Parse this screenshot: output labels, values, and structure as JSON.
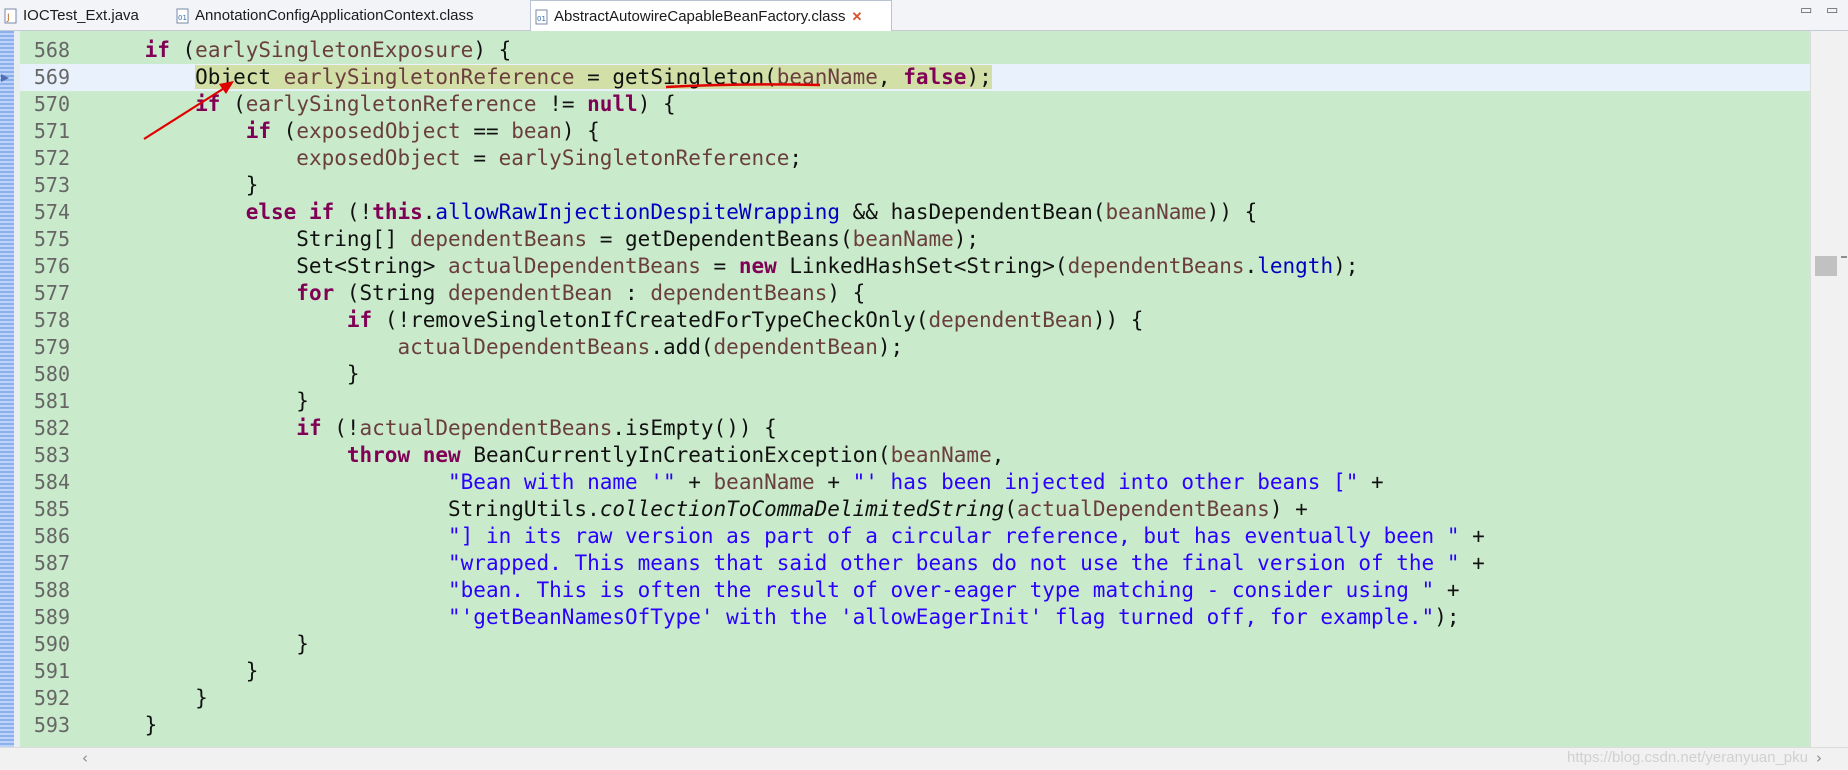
{
  "tabs": [
    {
      "label": "IOCTest_Ext.java",
      "icon": "java-file-icon",
      "active": false
    },
    {
      "label": "AnnotationConfigApplicationContext.class",
      "icon": "class-file-icon",
      "active": false
    },
    {
      "label": "AbstractAutowireCapableBeanFactory.class",
      "icon": "class-file-icon",
      "active": true
    }
  ],
  "tab_close_glyph": "✕",
  "window_controls": {
    "minimize": "▭",
    "maximize": "▭"
  },
  "colors": {
    "editor_bg": "#c9eacb",
    "keyword": "#7f0055",
    "local_var": "#6a3e3e",
    "field": "#0000c0",
    "string": "#2a00ff",
    "annotation_red": "#e00000"
  },
  "current_line": 569,
  "code_lines": [
    {
      "n": "568",
      "t": [
        [
          "",
          "    if (",
          "kw:if"
        ],
        [
          "lv",
          "earlySingletonExposure"
        ],
        [
          "",
          ") {"
        ]
      ]
    },
    {
      "n": "569",
      "t": [
        [
          "",
          "        Object "
        ],
        [
          "lv",
          "earlySingletonReference"
        ],
        [
          "",
          " = getSingleton("
        ],
        [
          "lv",
          "beanName"
        ],
        [
          "",
          ", "
        ],
        [
          "kw",
          "false"
        ],
        [
          "",
          ");"
        ]
      ]
    },
    {
      "n": "570",
      "t": [
        [
          "",
          "        "
        ],
        [
          "kw",
          "if"
        ],
        [
          "",
          " ("
        ],
        [
          "lv",
          "earlySingletonReference"
        ],
        [
          "",
          " != "
        ],
        [
          "kw",
          "null"
        ],
        [
          "",
          ") {"
        ]
      ]
    },
    {
      "n": "571",
      "t": [
        [
          "",
          "            "
        ],
        [
          "kw",
          "if"
        ],
        [
          "",
          " ("
        ],
        [
          "lv",
          "exposedObject"
        ],
        [
          "",
          " == "
        ],
        [
          "lv",
          "bean"
        ],
        [
          "",
          ") {"
        ]
      ]
    },
    {
      "n": "572",
      "t": [
        [
          "",
          "                "
        ],
        [
          "lv",
          "exposedObject"
        ],
        [
          "",
          " = "
        ],
        [
          "lv",
          "earlySingletonReference"
        ],
        [
          "",
          ";"
        ]
      ]
    },
    {
      "n": "573",
      "t": [
        [
          "",
          "            }"
        ]
      ]
    },
    {
      "n": "574",
      "t": [
        [
          "",
          "            "
        ],
        [
          "kw",
          "else"
        ],
        [
          "",
          " "
        ],
        [
          "kw",
          "if"
        ],
        [
          "",
          " (!"
        ],
        [
          "kw",
          "this"
        ],
        [
          "",
          "."
        ],
        [
          "fd",
          "allowRawInjectionDespiteWrapping"
        ],
        [
          "",
          " && hasDependentBean("
        ],
        [
          "lv",
          "beanName"
        ],
        [
          "",
          ")) {"
        ]
      ]
    },
    {
      "n": "575",
      "t": [
        [
          "",
          "                String[] "
        ],
        [
          "lv",
          "dependentBeans"
        ],
        [
          "",
          " = getDependentBeans("
        ],
        [
          "lv",
          "beanName"
        ],
        [
          "",
          ");"
        ]
      ]
    },
    {
      "n": "576",
      "t": [
        [
          "",
          "                Set<String> "
        ],
        [
          "lv",
          "actualDependentBeans"
        ],
        [
          "",
          " = "
        ],
        [
          "kw",
          "new"
        ],
        [
          "",
          " LinkedHashSet<String>("
        ],
        [
          "lv",
          "dependentBeans"
        ],
        [
          "",
          "."
        ],
        [
          "fd",
          "length"
        ],
        [
          "",
          ");"
        ]
      ]
    },
    {
      "n": "577",
      "t": [
        [
          "",
          "                "
        ],
        [
          "kw",
          "for"
        ],
        [
          "",
          " (String "
        ],
        [
          "lv",
          "dependentBean"
        ],
        [
          "",
          " : "
        ],
        [
          "lv",
          "dependentBeans"
        ],
        [
          "",
          ") {"
        ]
      ]
    },
    {
      "n": "578",
      "t": [
        [
          "",
          "                    "
        ],
        [
          "kw",
          "if"
        ],
        [
          "",
          " (!removeSingletonIfCreatedForTypeCheckOnly("
        ],
        [
          "lv",
          "dependentBean"
        ],
        [
          "",
          ")) {"
        ]
      ]
    },
    {
      "n": "579",
      "t": [
        [
          "",
          "                        "
        ],
        [
          "lv",
          "actualDependentBeans"
        ],
        [
          "",
          ".add("
        ],
        [
          "lv",
          "dependentBean"
        ],
        [
          "",
          ");"
        ]
      ]
    },
    {
      "n": "580",
      "t": [
        [
          "",
          "                    }"
        ]
      ]
    },
    {
      "n": "581",
      "t": [
        [
          "",
          "                }"
        ]
      ]
    },
    {
      "n": "582",
      "t": [
        [
          "",
          "                "
        ],
        [
          "kw",
          "if"
        ],
        [
          "",
          " (!"
        ],
        [
          "lv",
          "actualDependentBeans"
        ],
        [
          "",
          ".isEmpty()) {"
        ]
      ]
    },
    {
      "n": "583",
      "t": [
        [
          "",
          "                    "
        ],
        [
          "kw",
          "throw"
        ],
        [
          "",
          " "
        ],
        [
          "kw",
          "new"
        ],
        [
          "",
          " BeanCurrentlyInCreationException("
        ],
        [
          "lv",
          "beanName"
        ],
        [
          "",
          ","
        ]
      ]
    },
    {
      "n": "584",
      "t": [
        [
          "",
          "                            "
        ],
        [
          "st",
          "\"Bean with name '\""
        ],
        [
          "",
          " + "
        ],
        [
          "lv",
          "beanName"
        ],
        [
          "",
          " + "
        ],
        [
          "st",
          "\"' has been injected into other beans [\""
        ],
        [
          "",
          " +"
        ]
      ]
    },
    {
      "n": "585",
      "t": [
        [
          "",
          "                            StringUtils."
        ],
        [
          "it",
          "collectionToCommaDelimitedString"
        ],
        [
          "",
          "("
        ],
        [
          "lv",
          "actualDependentBeans"
        ],
        [
          "",
          ") +"
        ]
      ]
    },
    {
      "n": "586",
      "t": [
        [
          "",
          "                            "
        ],
        [
          "st",
          "\"] in its raw version as part of a circular reference, but has eventually been \""
        ],
        [
          "",
          " +"
        ]
      ]
    },
    {
      "n": "587",
      "t": [
        [
          "",
          "                            "
        ],
        [
          "st",
          "\"wrapped. This means that said other beans do not use the final version of the \""
        ],
        [
          "",
          " +"
        ]
      ]
    },
    {
      "n": "588",
      "t": [
        [
          "",
          "                            "
        ],
        [
          "st",
          "\"bean. This is often the result of over-eager type matching - consider using \""
        ],
        [
          "",
          " +"
        ]
      ]
    },
    {
      "n": "589",
      "t": [
        [
          "",
          "                            "
        ],
        [
          "st",
          "\"'getBeanNamesOfType' with the 'allowEagerInit' flag turned off, for example.\""
        ],
        [
          "",
          ");"
        ]
      ]
    },
    {
      "n": "590",
      "t": [
        [
          "",
          "                }"
        ]
      ]
    },
    {
      "n": "591",
      "t": [
        [
          "",
          "            }"
        ]
      ]
    },
    {
      "n": "592",
      "t": [
        [
          "",
          "        }"
        ]
      ]
    },
    {
      "n": "593",
      "t": [
        [
          "",
          "    }"
        ]
      ]
    }
  ],
  "scroll": {
    "left_arrow": "‹",
    "right_arrow": "›"
  },
  "watermark": "https://blog.csdn.net/yeranyuan_pku"
}
